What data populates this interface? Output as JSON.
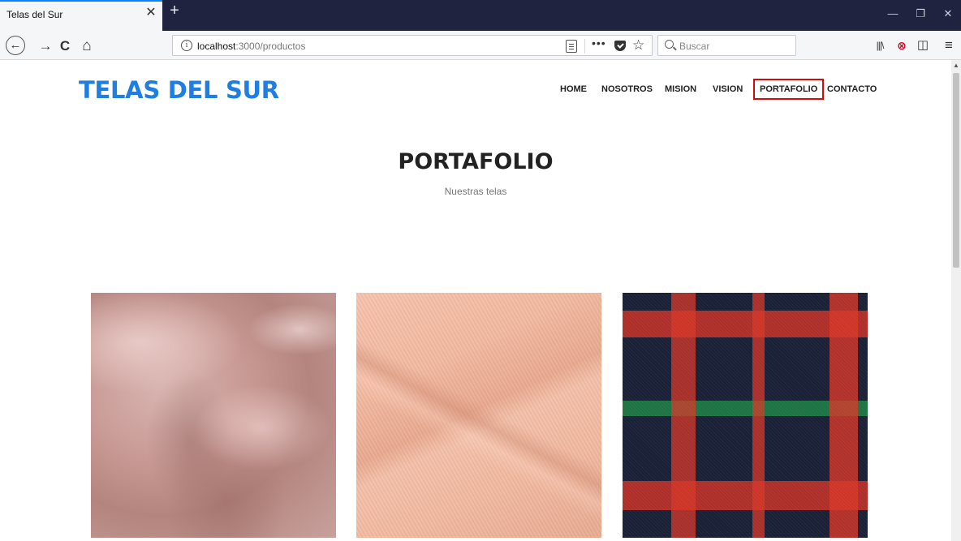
{
  "browser": {
    "tab_title": "Telas del Sur",
    "tab_close": "✕",
    "new_tab": "+",
    "url_host": "localhost",
    "url_path": ":3000/productos",
    "url_more": "•••",
    "url_star": "☆",
    "search_placeholder": "Buscar",
    "back": "←",
    "forward": "→",
    "reload": "C",
    "home": "⌂",
    "library": "|||\\",
    "blocked": "⊗",
    "sidebar": "◫",
    "menu": "≡",
    "minimize": "—",
    "restore": "❐",
    "close": "✕"
  },
  "site": {
    "brand": "TELAS DEL SUR",
    "nav": [
      {
        "label": "HOME",
        "active": false
      },
      {
        "label": "NOSOTROS",
        "active": false
      },
      {
        "label": "MISION",
        "active": false
      },
      {
        "label": "VISION",
        "active": false
      },
      {
        "label": "PORTAFOLIO",
        "active": true
      },
      {
        "label": "CONTACTO",
        "active": false
      }
    ]
  },
  "portfolio": {
    "title": "PORTAFOLIO",
    "subtitle": "Nuestras telas",
    "items": [
      {
        "name": "pink-chiffon"
      },
      {
        "name": "peach-twill"
      },
      {
        "name": "navy-plaid-flannel"
      }
    ]
  },
  "colors": {
    "brand": "#1e7fe0",
    "active_outline": "#d70a0a",
    "tabbar": "#202340"
  }
}
